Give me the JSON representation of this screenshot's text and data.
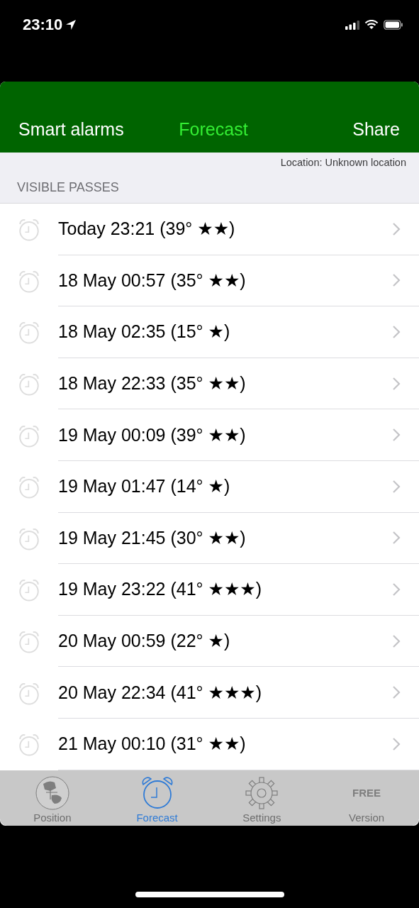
{
  "status_bar": {
    "time": "23:10"
  },
  "nav_bar": {
    "left": "Smart alarms",
    "title": "Forecast",
    "right": "Share"
  },
  "location": "Location: Unknown location",
  "section_header": "VISIBLE PASSES",
  "passes": [
    {
      "label": "Today 23:21 (39° ★★)"
    },
    {
      "label": "18 May 00:57 (35° ★★)"
    },
    {
      "label": "18 May 02:35 (15° ★)"
    },
    {
      "label": "18 May 22:33 (35° ★★)"
    },
    {
      "label": "19 May 00:09 (39° ★★)"
    },
    {
      "label": "19 May 01:47 (14° ★)"
    },
    {
      "label": "19 May 21:45 (30° ★★)"
    },
    {
      "label": "19 May 23:22 (41° ★★★)"
    },
    {
      "label": "20 May 00:59 (22° ★)"
    },
    {
      "label": "20 May 22:34 (41° ★★★)"
    },
    {
      "label": "21 May 00:10 (31° ★★)"
    }
  ],
  "tab_bar": [
    {
      "kind": "globe",
      "label": "Position",
      "selected": false
    },
    {
      "kind": "alarm",
      "label": "Forecast",
      "selected": true
    },
    {
      "kind": "gear",
      "label": "Settings",
      "selected": false
    },
    {
      "kind": "text",
      "icon_text": "FREE",
      "label": "Version",
      "selected": false
    }
  ]
}
